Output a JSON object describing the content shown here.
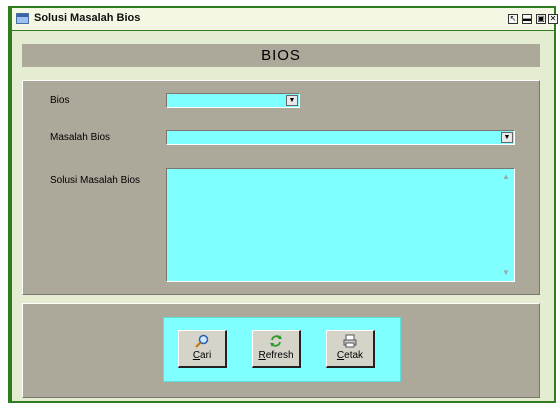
{
  "window": {
    "title": "Solusi Masalah Bios",
    "controls": {
      "help": "↖",
      "minimize": "▬",
      "maximize": "▣",
      "close": "✕"
    }
  },
  "banner": {
    "title": "BIOS"
  },
  "form": {
    "bios_label": "Bios",
    "bios_value": "",
    "masalah_label": "Masalah Bios",
    "masalah_value": "",
    "solusi_label": "Solusi Masalah Bios",
    "solusi_value": ""
  },
  "buttons": {
    "cari": {
      "accel": "C",
      "rest": "ari",
      "icon": "search-icon"
    },
    "refresh": {
      "accel": "R",
      "rest": "efresh",
      "icon": "refresh-icon"
    },
    "cetak": {
      "accel": "C",
      "rest": "etak",
      "icon": "printer-icon"
    }
  },
  "colors": {
    "field": "#7fffff",
    "panel": "#aca89a",
    "frame": "#2f7d1f"
  }
}
